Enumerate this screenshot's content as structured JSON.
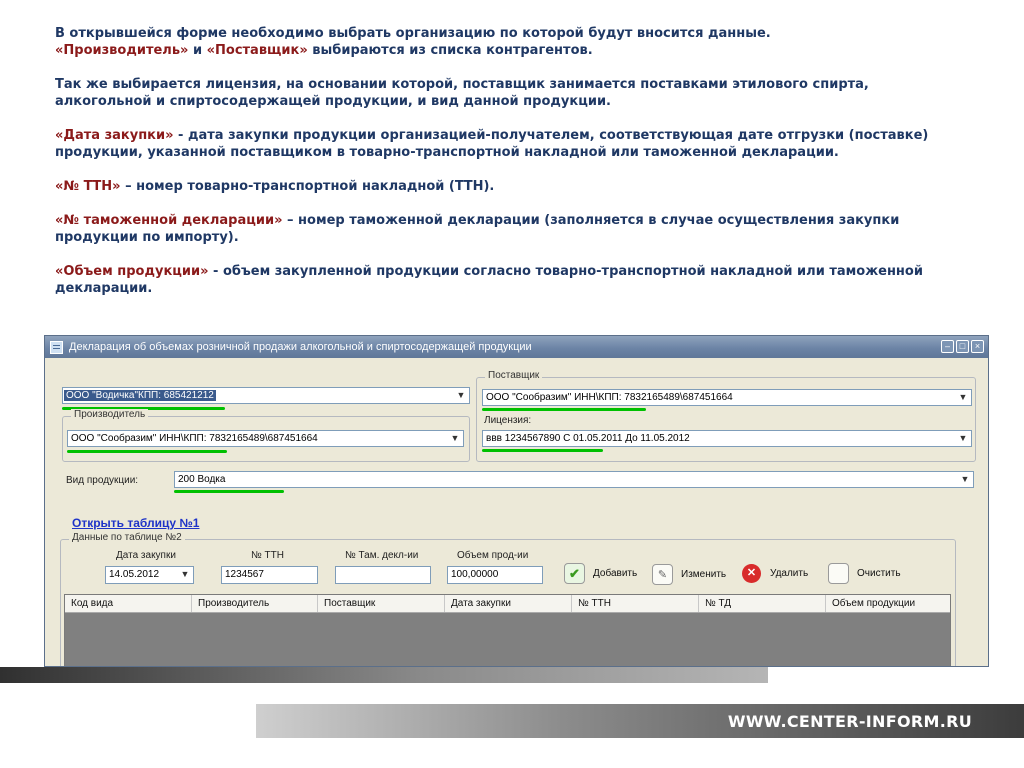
{
  "slide": {
    "p1": {
      "a": "В открывшейся форме необходимо выбрать организацию по которой будут вносится данные.",
      "t1": "«Производитель»",
      "mid": " и ",
      "t2": "«Поставщик»",
      "rest": " выбираются из списка контрагентов."
    },
    "p2": "Так же выбирается лицензия, на основании которой, поставщик занимается поставками этилового спирта, алкогольной и спиртосодержащей продукции, и вид данной продукции.",
    "p3": {
      "t": "«Дата закупки»",
      "rest": " - дата закупки  продукции организацией-получателем, соответствующая дате отгрузки (поставке) продукции, указанной поставщиком в товарно-транспортной накладной или таможенной декларации."
    },
    "p4": {
      "t": "«№ ТТН»",
      "rest": " – номер товарно-транспортной накладной (ТТН)."
    },
    "p5": {
      "t": "«№ таможенной декларации»",
      "rest": " – номер таможенной декларации (заполняется в случае осуществления закупки продукции по импорту)."
    },
    "p6": {
      "t": "«Объем продукции»",
      "rest": " - объем закупленной продукции согласно товарно-транспортной накладной или таможенной декларации."
    }
  },
  "window": {
    "title": "Декларация об объемах розничной продажи алкогольной и спиртосодержащей продукции",
    "buttons": {
      "minimize": "–",
      "maximize": "□",
      "close": "×"
    }
  },
  "form": {
    "organization": {
      "value": "ООО \"Водичка\"КПП: 685421212"
    },
    "producer": {
      "legend": "Производитель",
      "value": "ООО \"Сообразим\"  ИНН\\КПП: 7832165489\\687451664"
    },
    "supplier": {
      "legend": "Поставщик",
      "value": "ООО \"Сообразим\"  ИНН\\КПП:  7832165489\\687451664"
    },
    "license": {
      "label": "Лицензия:",
      "value": "ввв  1234567890 С 01.05.2011 До 11.05.2012"
    },
    "product_type": {
      "label": "Вид продукции:",
      "value": "200 Водка"
    },
    "open_table_link": "Открыть таблицу №1",
    "table2": {
      "legend": "Данные по таблице №2",
      "labels": {
        "date": "Дата закупки",
        "ttn": "№ ТТН",
        "customs": "№ Там. декл-ии",
        "volume": "Объем прод-ии"
      },
      "values": {
        "date": "14.05.2012",
        "ttn": "1234567",
        "customs": "",
        "volume": "100,00000"
      },
      "actions": {
        "add": "Добавить",
        "edit": "Изменить",
        "delete": "Удалить",
        "clear": "Очистить"
      },
      "columns": [
        "Код вида",
        "Производитель",
        "Поставщик",
        "Дата закупки",
        "№ ТТН",
        "№ ТД",
        "Объем продукции"
      ]
    }
  },
  "icons": {
    "dropdown": "chevron-down-icon",
    "add": "checkmark-icon",
    "edit": "pencil-icon",
    "delete": "delete-icon"
  },
  "colors": {
    "slide_text": "#1f3864",
    "term_text": "#8b1a1a",
    "highlight_underline": "#00c000",
    "link": "#1e33c8",
    "selected_combo": "#3a5a8c"
  },
  "footer": {
    "site": "WWW.CENTER-INFORM.RU"
  }
}
